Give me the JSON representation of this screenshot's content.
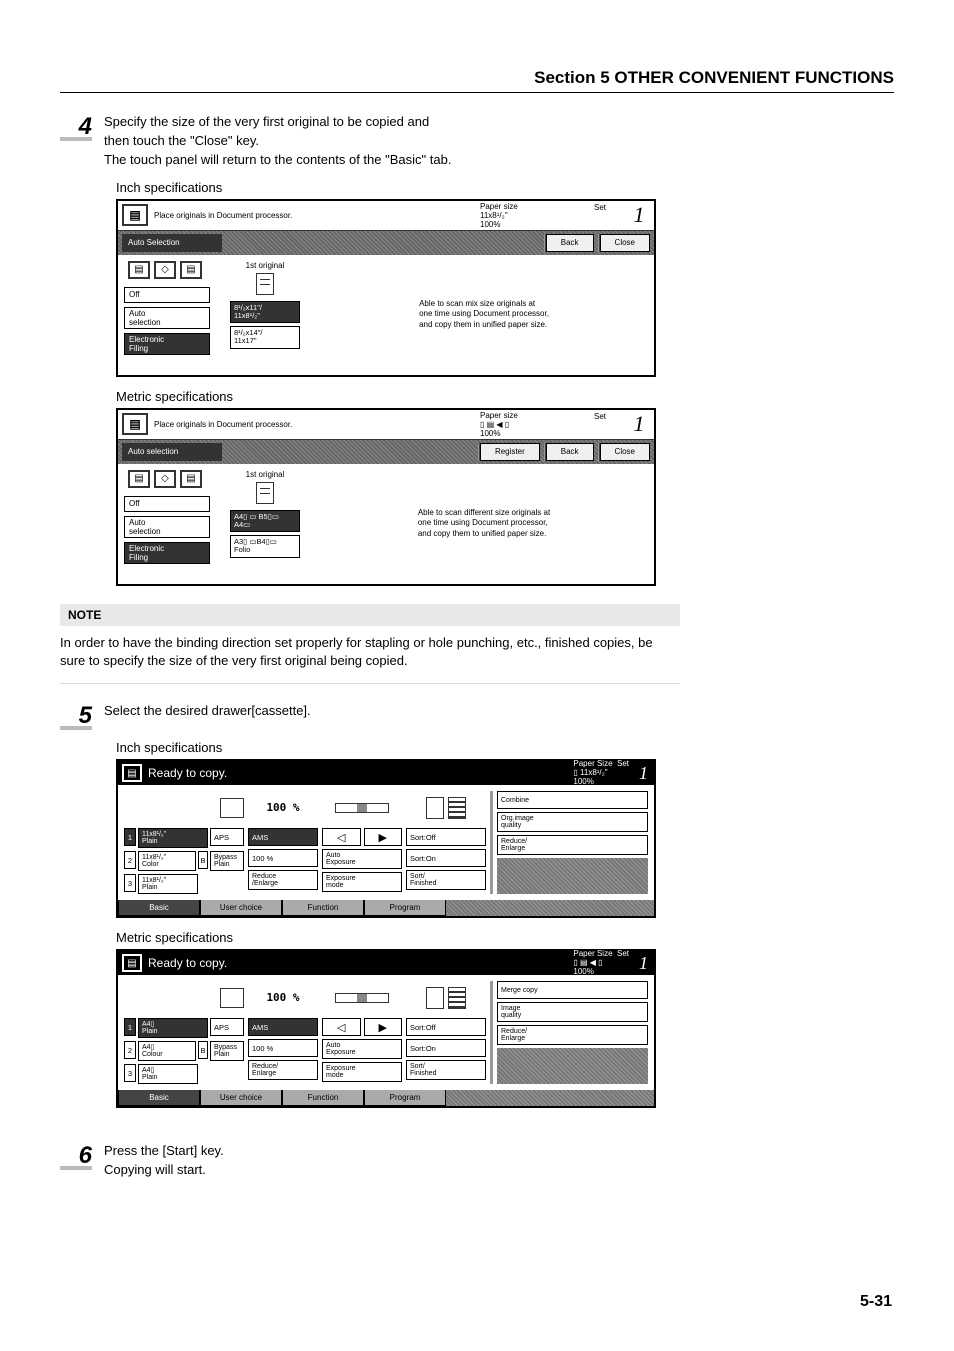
{
  "header": {
    "title": "Section 5  OTHER CONVENIENT FUNCTIONS"
  },
  "step4": {
    "num": "4",
    "line1": "Specify the size of the very first original to be copied and",
    "line2": "then touch the \"Close\" key.",
    "line3": "The touch panel will return to the contents of the \"Basic\" tab.",
    "inch_label": "Inch specifications",
    "metric_label": "Metric specifications"
  },
  "panel_a": {
    "msg": "Place originals in Document processor.",
    "paper_label": "Paper size",
    "paper_val": "11x8¹/₂\"",
    "hundred": "100%",
    "set": "Set",
    "count": "1",
    "tab": "Auto Selection",
    "back": "Back",
    "close": "Close",
    "mid_label": "1st original",
    "off": "Off",
    "auto_sel": "Auto\nselection",
    "elec": "Electronic\nFiling",
    "chip1": "8¹/₂x11\"/\n11x8¹/₂\"",
    "chip2": "8¹/₂x14\"/\n11x17\"",
    "info": "Able to scan mix size originals at\none time using Document processor,\nand copy them in unified paper size."
  },
  "panel_b": {
    "msg": "Place originals in Document processor.",
    "paper_label": "Paper size",
    "set": "Set",
    "count": "1",
    "hundred": "100%",
    "tab": "Auto selection",
    "register": "Register",
    "back": "Back",
    "close": "Close",
    "mid_label": "1st original",
    "off": "Off",
    "auto_sel": "Auto\nselection",
    "elec": "Electronic\nFiling",
    "chip1": "A4▯ ▭ B5▯▭\nA4▭",
    "chip2": "A3▯ ▭B4▯▭\nFolio",
    "info": "Able to scan different size originals at\none time using Document processor,\nand copy them to unified paper size."
  },
  "note": {
    "head": "NOTE",
    "body": "In order to have the binding direction set properly for stapling or hole punching, etc., finished copies, be sure to specify the size of the very first original being copied."
  },
  "step5": {
    "num": "5",
    "line1": "Select the desired drawer[cassette].",
    "inch_label": "Inch specifications",
    "metric_label": "Metric specifications"
  },
  "cpanel_a": {
    "title": "Ready to copy.",
    "psize": "Paper Size",
    "psize_val": "11x8¹/₂\"",
    "hundred": "100%",
    "set": "Set",
    "count": "1",
    "c1_r1a": "1",
    "c1_r1b": "11x8¹/₂\"\nPlain",
    "c1_r1c": "APS",
    "c1_r2a": "2",
    "c1_r2b": "11x8¹/₂\"\nColor",
    "c1_r2c": "B",
    "c1_r2d": "Bypass\nPlain",
    "c1_r3a": "3",
    "c1_r3b": "11x8¹/₂\"\nPlain",
    "c2_pct": "100",
    "c2_ams": "AMS",
    "c2_100": "100 %",
    "c2_re": "Reduce\n/Enlarge",
    "c4_ae": "Auto\nExposure",
    "c4_em": "Exposure\nmode",
    "c5_so": "Sort:Off",
    "c5_son": "Sort:On",
    "c5_sf": "Sort/\nFinished",
    "c6_a": "Combine",
    "c6_b": "Org.image\nquality",
    "c6_c": "Reduce/\nEnlarge",
    "tabs": {
      "basic": "Basic",
      "user": "User choice",
      "func": "Function",
      "prog": "Program"
    }
  },
  "cpanel_b": {
    "title": "Ready to copy.",
    "psize": "Paper Size",
    "set": "Set",
    "count": "1",
    "hundred": "100%",
    "c1_r1a": "1",
    "c1_r1b": "A4▯\nPlain",
    "c1_r1c": "APS",
    "c1_r2a": "2",
    "c1_r2b": "A4▯\nColour",
    "c1_r2c": "B",
    "c1_r2d": "Bypass\nPlain",
    "c1_r3a": "3",
    "c1_r3b": "A4▯\nPlain",
    "c2_pct": "100",
    "c2_ams": "AMS",
    "c2_100": "100 %",
    "c2_re": "Reduce/\nEnlarge",
    "c4_ae": "Auto\nExposure",
    "c4_em": "Exposure\nmode",
    "c5_so": "Sort:Off",
    "c5_son": "Sort:On",
    "c5_sf": "Sort/\nFinished",
    "c6_a": "Merge copy",
    "c6_b": "Image\nquality",
    "c6_c": "Reduce/\nEnlarge",
    "tabs": {
      "basic": "Basic",
      "user": "User choice",
      "func": "Function",
      "prog": "Program"
    }
  },
  "step6": {
    "num": "6",
    "line1": "Press the [Start] key.",
    "line2": "Copying will start."
  },
  "page_num": "5-31"
}
